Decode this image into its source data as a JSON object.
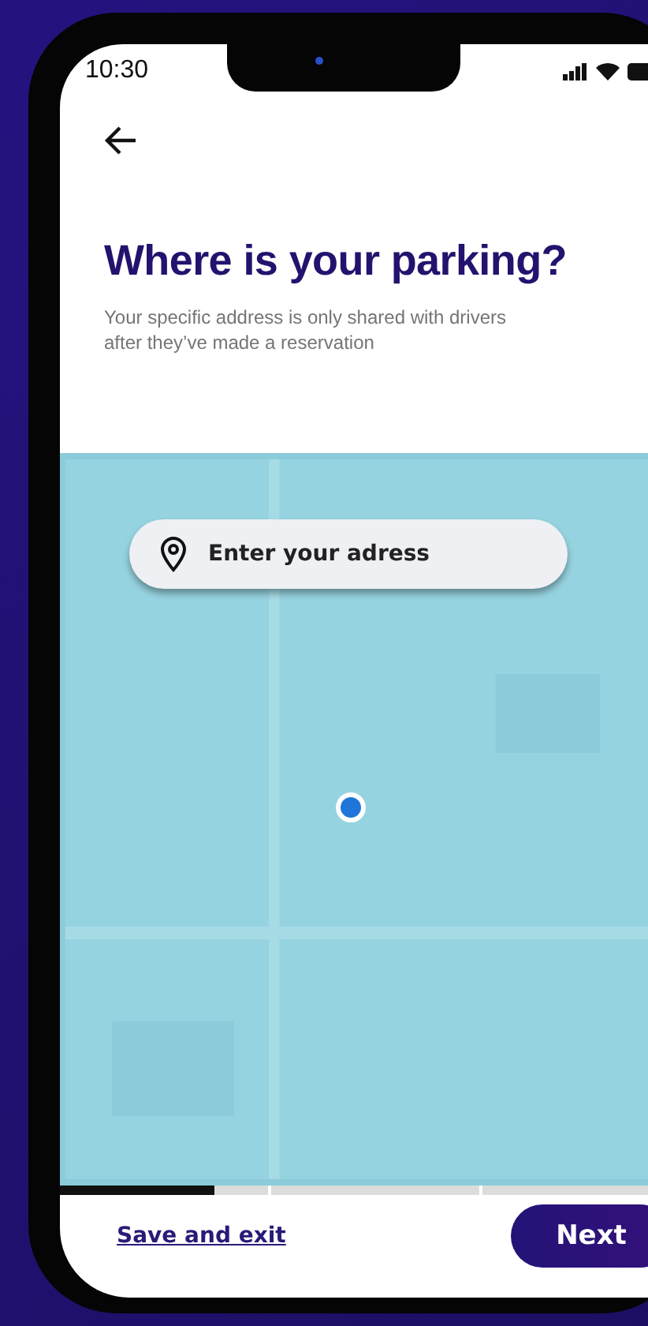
{
  "status_bar": {
    "time": "10:30"
  },
  "title": "Where is your parking?",
  "subtitle": "Your specific address is only shared with drivers after they’ve made a reservation",
  "map": {
    "kind": "picture",
    "search": {
      "placeholder": "Enter your adress"
    }
  },
  "progress": [
    {
      "level": 0.74
    },
    {
      "level": 0
    },
    {
      "level": 0
    }
  ],
  "footer": {
    "link": "Save and exit",
    "button": "Next"
  }
}
